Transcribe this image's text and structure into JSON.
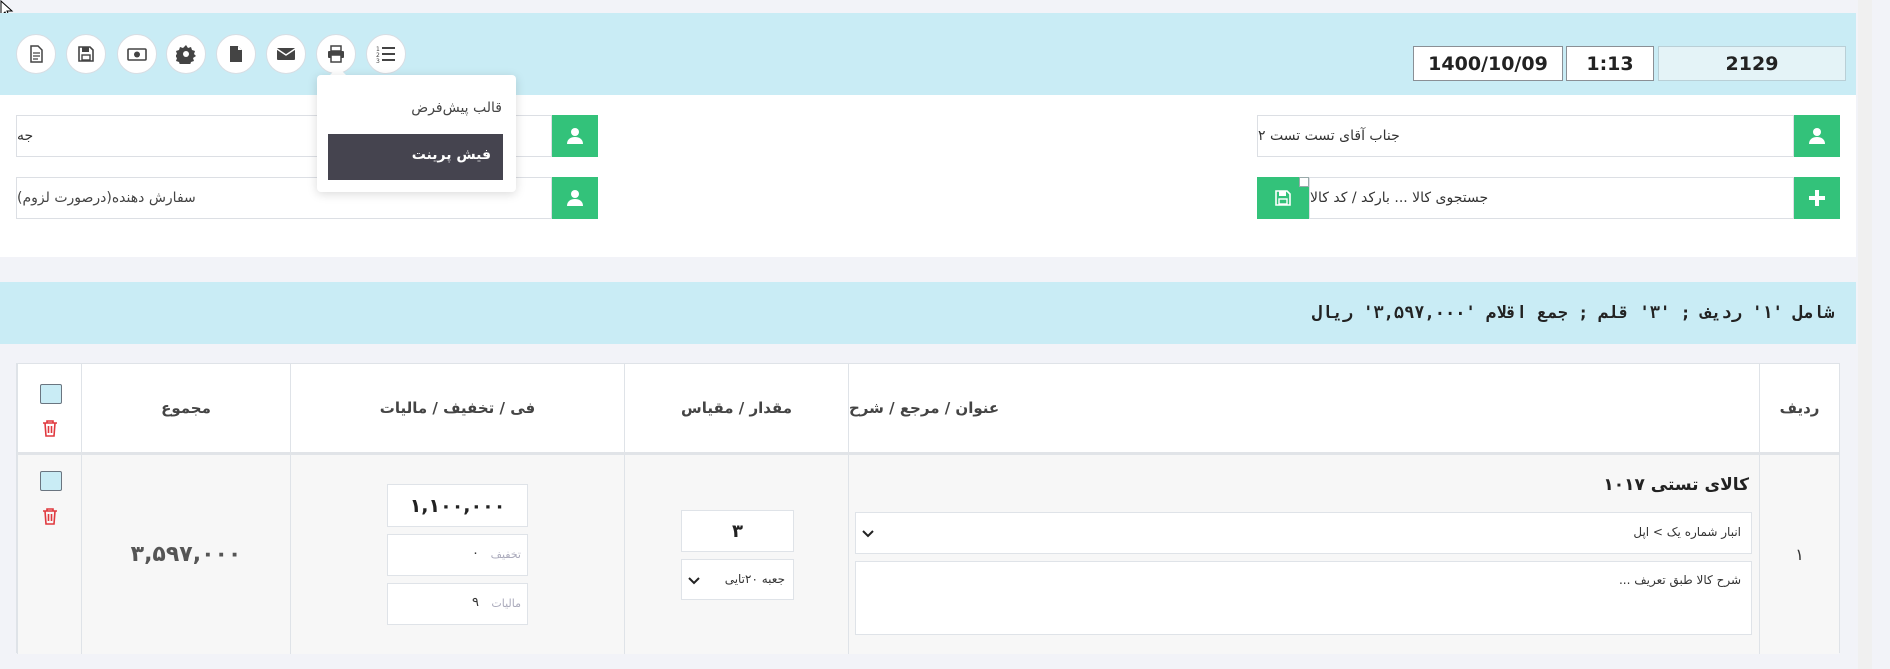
{
  "header": {
    "doc_number": "2129",
    "time": "1:13",
    "date": "1400/10/09"
  },
  "toolbar": {
    "buttons": [
      {
        "name": "new-document",
        "icon": "file-text-icon"
      },
      {
        "name": "save",
        "icon": "save-icon"
      },
      {
        "name": "payment",
        "icon": "money-icon"
      },
      {
        "name": "settings",
        "icon": "gear-icon"
      },
      {
        "name": "file",
        "icon": "file-icon"
      },
      {
        "name": "email",
        "icon": "envelope-icon"
      },
      {
        "name": "print",
        "icon": "print-icon"
      },
      {
        "name": "numbered-list",
        "icon": "numbered-list-icon"
      }
    ]
  },
  "print_menu": {
    "items": [
      "قالب پیش‌فرض",
      "فیش پرینت"
    ],
    "active_index": 1
  },
  "form": {
    "customer_value": "جناب آقای تست تست ۲",
    "product_search_placeholder": "جستجوی کالا ... بارکد / کد کالا",
    "left_field_1_value": "جه",
    "orderer_placeholder": "سفارش دهنده(درصورت لزوم)"
  },
  "summary": {
    "text": "شامل '۱' ردیف ; '۳' قلم ; جمع اقلام '۳,۵۹۷,۰۰۰' ریال"
  },
  "table": {
    "headers": {
      "row": "ردیف",
      "title": "عنوان / مرجع / شرح",
      "quantity": "مقدار / مقیاس",
      "price": "فی / تخفیف / مالیات",
      "total": "مجموع"
    },
    "rows": [
      {
        "row_number": "۱",
        "product_name": "کالای تستی ۱۰۱۷",
        "warehouse": "انبار شماره یک > اپل",
        "description": "شرح کالا طبق تعریف ...",
        "quantity": "۳",
        "unit": "جعبه ۲۰تایی",
        "price": "۱,۱۰۰,۰۰۰",
        "discount_label": "تخفیف",
        "discount": "۰",
        "tax_label": "مالیات",
        "tax": "۹",
        "total": "۳,۵۹۷,۰۰۰"
      }
    ]
  },
  "colors": {
    "accent_green": "#33c27a",
    "header_band": "#c9ecf5",
    "delete_red": "#e0383e",
    "menu_active_bg": "#45444f"
  }
}
